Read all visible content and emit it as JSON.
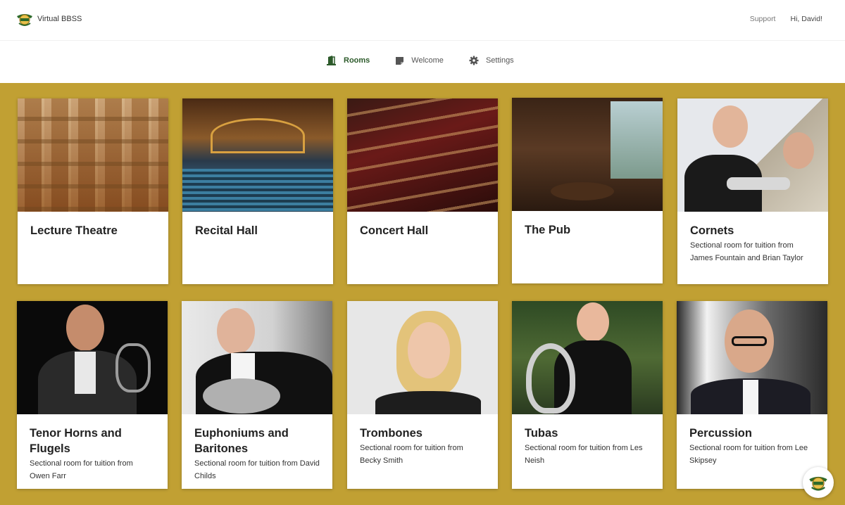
{
  "app": {
    "name": "Virtual BBSS",
    "logo_icon": "bbss-crest-logo"
  },
  "topbar": {
    "support_label": "Support",
    "user_greeting": "Hi, David!"
  },
  "nav": {
    "tabs": [
      {
        "label": "Rooms",
        "icon": "door-icon",
        "active": true
      },
      {
        "label": "Welcome",
        "icon": "note-icon",
        "active": false
      },
      {
        "label": "Settings",
        "icon": "gear-icon",
        "active": false
      }
    ]
  },
  "colors": {
    "background": "#c1a033",
    "accent": "#2c5a2a"
  },
  "rooms": [
    {
      "title": "Lecture Theatre",
      "description": "",
      "image": "lecture-theatre-seats-photo"
    },
    {
      "title": "Recital Hall",
      "description": "",
      "image": "recital-hall-photo"
    },
    {
      "title": "Concert Hall",
      "description": "",
      "image": "concert-hall-balconies-photo"
    },
    {
      "title": "The Pub",
      "description": "",
      "image": "pub-interior-photo"
    },
    {
      "title": "Cornets",
      "description": "Sectional room for tuition from James Fountain and Brian Taylor",
      "image": "cornet-players-photo"
    },
    {
      "title": "Tenor Horns and Flugels",
      "description": "Sectional room for tuition from Owen Farr",
      "image": "tenor-horn-player-photo"
    },
    {
      "title": "Euphoniums and Baritones",
      "description": "Sectional room for tuition from David Childs",
      "image": "euphonium-player-photo"
    },
    {
      "title": "Trombones",
      "description": "Sectional room for tuition from Becky Smith",
      "image": "trombone-teacher-photo"
    },
    {
      "title": "Tubas",
      "description": "Sectional room for tuition from Les Neish",
      "image": "tuba-player-photo"
    },
    {
      "title": "Percussion",
      "description": "Sectional room for tuition from Lee Skipsey",
      "image": "percussion-teacher-photo"
    }
  ]
}
